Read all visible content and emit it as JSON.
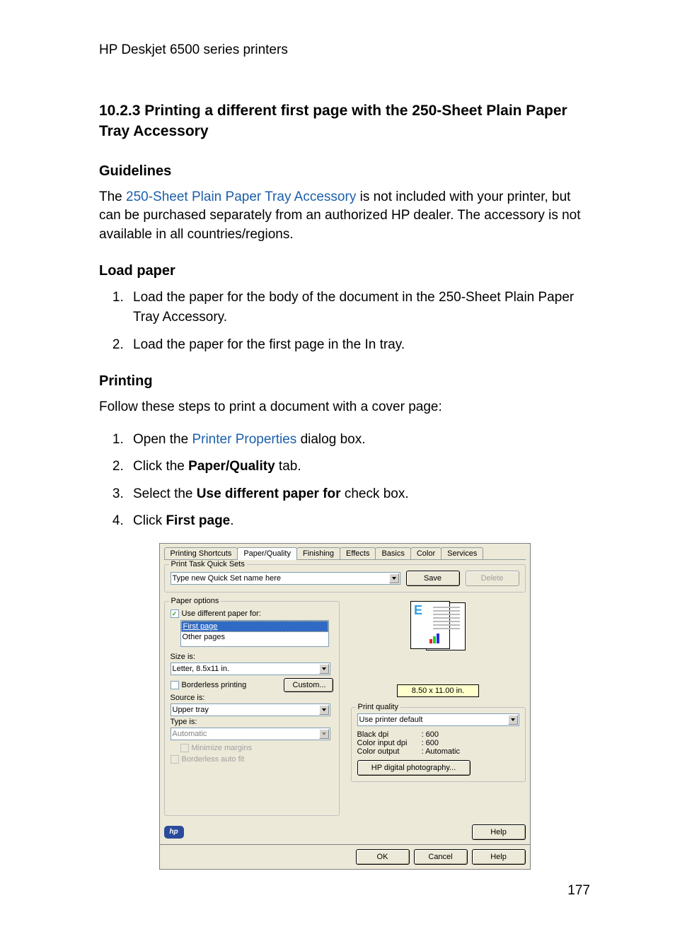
{
  "header": {
    "product": "HP Deskjet 6500 series printers"
  },
  "section": {
    "title": "10.2.3  Printing a different first page with the 250-Sheet Plain Paper Tray Accessory",
    "guidelines_heading": "Guidelines",
    "guidelines_pre": "The ",
    "guidelines_link": "250-Sheet Plain Paper Tray Accessory",
    "guidelines_post": " is not included with your printer, but can be purchased separately from an authorized HP dealer. The accessory is not available in all countries/regions.",
    "load_heading": "Load paper",
    "load_steps": [
      "Load the paper for the body of the document in the 250-Sheet Plain Paper Tray Accessory.",
      "Load the paper for the first page in the In tray."
    ],
    "printing_heading": "Printing",
    "printing_intro": "Follow these steps to print a document with a cover page:",
    "printing_steps": {
      "s1_pre": "Open the ",
      "s1_link": "Printer Properties",
      "s1_post": " dialog box.",
      "s2_pre": "Click the ",
      "s2_bold": "Paper/Quality",
      "s2_post": " tab.",
      "s3_pre": "Select the ",
      "s3_bold": "Use different paper for",
      "s3_post": " check box.",
      "s4_pre": "Click ",
      "s4_bold": "First page",
      "s4_post": "."
    }
  },
  "page_number": "177",
  "dialog": {
    "tabs": [
      "Printing Shortcuts",
      "Paper/Quality",
      "Finishing",
      "Effects",
      "Basics",
      "Color",
      "Services"
    ],
    "active_tab_index": 1,
    "quicksets": {
      "legend": "Print Task Quick Sets",
      "input_value": "Type new Quick Set name here",
      "save": "Save",
      "delete": "Delete"
    },
    "paper_options": {
      "legend": "Paper options",
      "use_different": "Use different paper for:",
      "use_different_checked": true,
      "pages_list": [
        "First page",
        "Other pages"
      ],
      "pages_selected_index": 0,
      "size_label": "Size is:",
      "size_value": "Letter, 8.5x11 in.",
      "borderless": "Borderless printing",
      "borderless_checked": false,
      "custom_btn": "Custom...",
      "source_label": "Source is:",
      "source_value": "Upper tray",
      "type_label": "Type is:",
      "type_value": "Automatic",
      "minimize": "Minimize margins",
      "minimize_checked": false,
      "borderless_autofit": "Borderless auto fit"
    },
    "preview": {
      "size_badge": "8.50 x 11.00 in."
    },
    "print_quality": {
      "legend": "Print quality",
      "select_value": "Use printer default",
      "black_label": "Black dpi",
      "black_value": ": 600",
      "color_input_label": "Color input dpi",
      "color_input_value": ": 600",
      "color_output_label": "Color output",
      "color_output_value": ": Automatic",
      "hp_digital_btn": "HP digital photography..."
    },
    "hp_logo": "hp",
    "help_btn": "Help",
    "buttons": {
      "ok": "OK",
      "cancel": "Cancel",
      "help": "Help"
    }
  }
}
